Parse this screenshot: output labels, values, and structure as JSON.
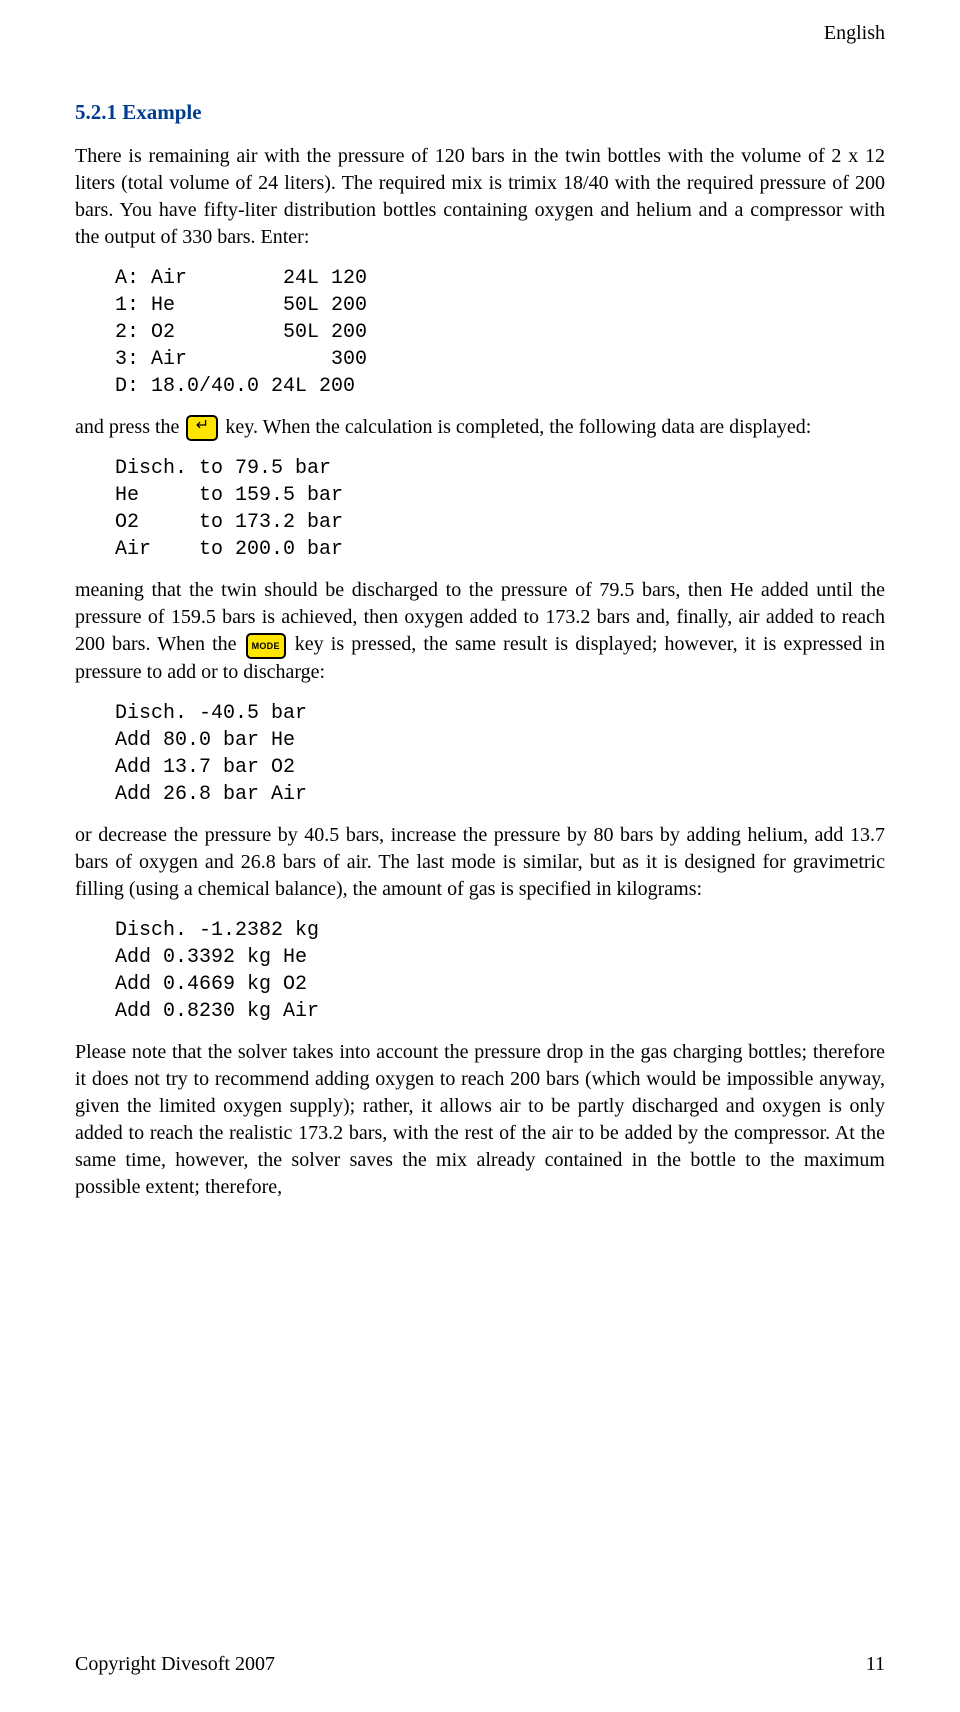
{
  "header": {
    "language": "English"
  },
  "section": {
    "heading": "5.2.1 Example"
  },
  "para1": "There is remaining air with the pressure of 120 bars in the twin bottles with the volume of 2 x 12 liters (total volume of 24 liters). The required mix is trimix 18/40 with the required pressure of 200 bars. You have fifty-liter distribution bottles containing oxygen and helium and a compressor with the output of 330 bars. Enter:",
  "input_block": "A: Air        24L 120\n1: He         50L 200\n2: O2         50L 200\n3: Air            300\nD: 18.0/40.0 24L 200",
  "para2a": "and press the ",
  "para2b": " key. When the calculation is completed, the following data are displayed:",
  "output_block1": "Disch. to 79.5 bar\nHe     to 159.5 bar\nO2     to 173.2 bar\nAir    to 200.0 bar",
  "para3a": "meaning that the twin should be discharged to the pressure of 79.5 bars, then He added until the pressure of 159.5 bars is achieved, then oxygen added to 173.2 bars and, finally, air added to reach 200 bars. When the ",
  "para3b": " key is pressed, the same result is displayed; however, it is expressed in pressure to add or to discharge:",
  "output_block2": "Disch. -40.5 bar\nAdd 80.0 bar He\nAdd 13.7 bar O2\nAdd 26.8 bar Air",
  "para4": "or decrease the pressure by 40.5 bars, increase the pressure by 80 bars by adding helium, add 13.7 bars of oxygen and 26.8 bars of air. The last mode is similar, but as it is designed for gravimetric filling (using a chemical balance), the amount of gas is specified in kilograms:",
  "output_block3": "Disch. -1.2382 kg\nAdd 0.3392 kg He\nAdd 0.4669 kg O2\nAdd 0.8230 kg Air",
  "para5": "Please note that the solver takes into account the pressure drop in the gas charging bottles; therefore it does not try to recommend adding oxygen to reach 200 bars (which would be impossible anyway, given the limited oxygen supply); rather, it allows air to be partly discharged and oxygen is only added to reach the realistic 173.2 bars, with the rest of the air to be added by the compressor. At the same time, however, the solver saves the mix already contained in the bottle to the maximum possible extent; therefore,",
  "footer": {
    "copyright": "Copyright Divesoft 2007",
    "page": "11"
  }
}
